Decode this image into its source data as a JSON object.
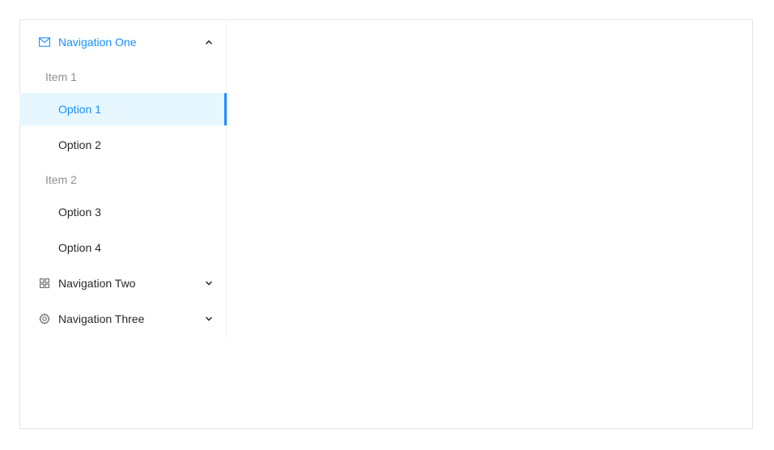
{
  "menu": {
    "nav_one": {
      "label": "Navigation One",
      "icon": "mail-icon",
      "expanded": true,
      "groups": [
        {
          "title": "Item 1",
          "items": [
            {
              "label": "Option 1",
              "selected": true
            },
            {
              "label": "Option 2",
              "selected": false
            }
          ]
        },
        {
          "title": "Item 2",
          "items": [
            {
              "label": "Option 3",
              "selected": false
            },
            {
              "label": "Option 4",
              "selected": false
            }
          ]
        }
      ]
    },
    "nav_two": {
      "label": "Navigation Two",
      "icon": "appstore-icon",
      "expanded": false
    },
    "nav_three": {
      "label": "Navigation Three",
      "icon": "setting-icon",
      "expanded": false
    }
  },
  "colors": {
    "accent": "#1890ff",
    "selected_bg": "#e6f7ff",
    "text": "#262626",
    "muted": "#8c8c8c"
  }
}
